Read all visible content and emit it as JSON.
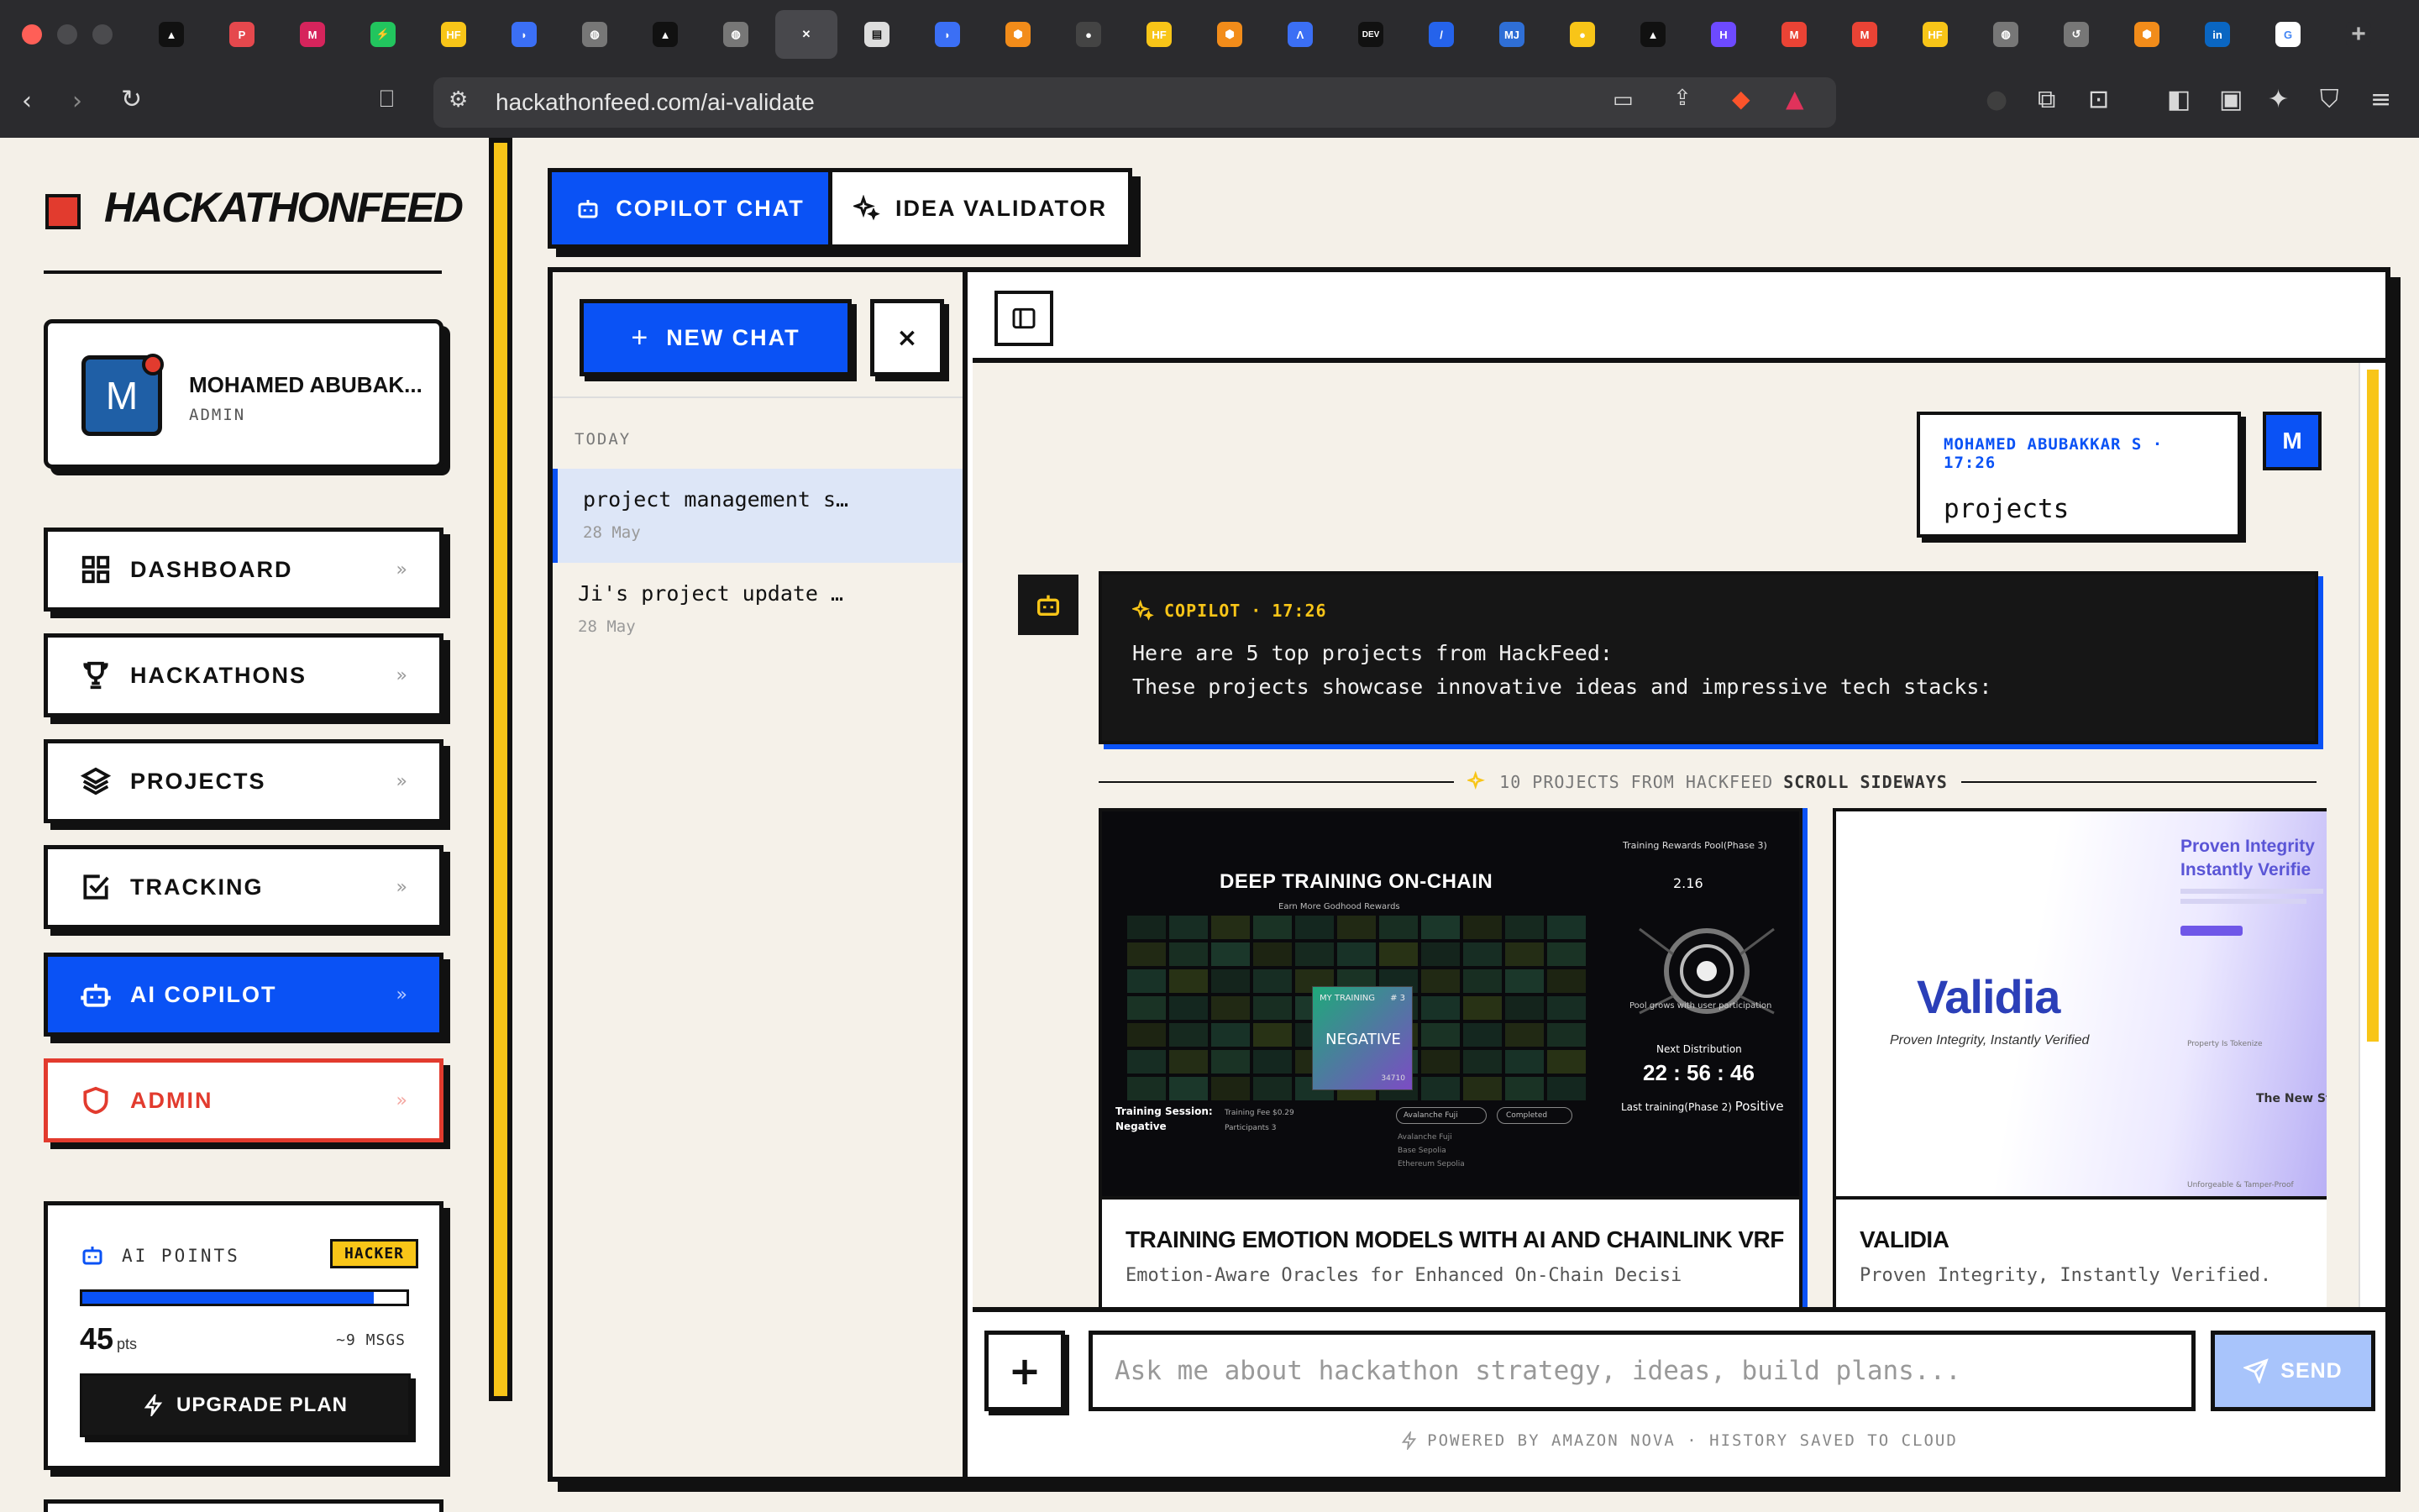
{
  "browser": {
    "url": "hackathonfeed.com/ai-validate",
    "tabs": [
      {
        "icon": "triangle-logo",
        "color": "#111111",
        "glyph": "▲"
      },
      {
        "icon": "producthunt-icon",
        "color": "#e5484d",
        "glyph": "P"
      },
      {
        "icon": "mail-icon",
        "color": "#d6245c",
        "glyph": "M"
      },
      {
        "icon": "bolt-icon",
        "color": "#22c55e",
        "glyph": "⚡"
      },
      {
        "icon": "hf-icon",
        "color": "#f8c518",
        "glyph": "HF"
      },
      {
        "icon": "blue-app-icon",
        "color": "#3b6ff5",
        "glyph": "◗"
      },
      {
        "icon": "globe-icon",
        "color": "#777777",
        "glyph": "◍"
      },
      {
        "icon": "triangle-logo",
        "color": "#111111",
        "glyph": "▲"
      },
      {
        "icon": "globe-icon",
        "color": "#777777",
        "glyph": "◍"
      },
      {
        "icon": "close-icon",
        "color": "#48484c",
        "glyph": "✕"
      },
      {
        "icon": "table-icon",
        "color": "#dddddd",
        "glyph": "▤"
      },
      {
        "icon": "blue-app-icon",
        "color": "#3b6ff5",
        "glyph": "◗"
      },
      {
        "icon": "cube-icon",
        "color": "#f28c1a",
        "glyph": "⬢"
      },
      {
        "icon": "github-icon",
        "color": "#444444",
        "glyph": "●"
      },
      {
        "icon": "hf-icon",
        "color": "#f8c518",
        "glyph": "HF"
      },
      {
        "icon": "cube-icon",
        "color": "#f28c1a",
        "glyph": "⬢"
      },
      {
        "icon": "a-logo-icon",
        "color": "#3b6ff5",
        "glyph": "Λ"
      },
      {
        "icon": "dev-icon",
        "color": "#111111",
        "glyph": "DEV"
      },
      {
        "icon": "slash-icon",
        "color": "#2563eb",
        "glyph": "/"
      },
      {
        "icon": "mj-icon",
        "color": "#2f6fd6",
        "glyph": "MJ"
      },
      {
        "icon": "bulb-icon",
        "color": "#f8c518",
        "glyph": "●"
      },
      {
        "icon": "triangle-logo",
        "color": "#111111",
        "glyph": "▲"
      },
      {
        "icon": "h-logo-icon",
        "color": "#6d4aff",
        "glyph": "H"
      },
      {
        "icon": "gmail-icon",
        "color": "#ea4335",
        "glyph": "M"
      },
      {
        "icon": "gmail-icon",
        "color": "#ea4335",
        "glyph": "M"
      },
      {
        "icon": "hf-icon",
        "color": "#f8c518",
        "glyph": "HF"
      },
      {
        "icon": "globe-icon",
        "color": "#777777",
        "glyph": "◍"
      },
      {
        "icon": "history-icon",
        "color": "#777777",
        "glyph": "↺"
      },
      {
        "icon": "cube-icon",
        "color": "#f28c1a",
        "glyph": "⬢"
      },
      {
        "icon": "linkedin-icon",
        "color": "#0a66c2",
        "glyph": "in"
      },
      {
        "icon": "google-icon",
        "color": "#ffffff",
        "glyph": "G"
      },
      {
        "icon": "new-tab-icon",
        "color": "#2b2b2e",
        "glyph": "+"
      }
    ]
  },
  "sidebar": {
    "logo": "HACKATHONFEED",
    "profile": {
      "initial": "M",
      "name": "MOHAMED ABUBAK...",
      "role": "ADMIN"
    },
    "nav": [
      {
        "label": "DASHBOARD",
        "icon": "grid-icon"
      },
      {
        "label": "HACKATHONS",
        "icon": "trophy-icon"
      },
      {
        "label": "PROJECTS",
        "icon": "layers-icon"
      },
      {
        "label": "TRACKING",
        "icon": "checkbox-icon"
      },
      {
        "label": "AI COPILOT",
        "icon": "robot-icon",
        "active": true
      },
      {
        "label": "ADMIN",
        "icon": "shield-icon",
        "danger": true
      }
    ],
    "nav_chevron": "»",
    "points": {
      "label": "AI POINTS",
      "badge": "HACKER",
      "value": "45",
      "unit": "pts",
      "messages": "~9 MSGS",
      "progress": 0.9,
      "upgrade_label": "UPGRADE PLAN"
    }
  },
  "mode_tabs": {
    "copilot": "COPILOT CHAT",
    "validator": "IDEA VALIDATOR"
  },
  "history": {
    "new_chat_label": "NEW CHAT",
    "close_glyph": "×",
    "section": "TODAY",
    "items": [
      {
        "title": "project management s…",
        "date": "28 May",
        "active": true
      },
      {
        "title": "Ji's project update …",
        "date": "28 May"
      }
    ]
  },
  "chat": {
    "user_message": {
      "author": "MOHAMED ABUBAKKAR S",
      "time": "17:26",
      "text": "projects",
      "avatar": "M"
    },
    "bot_message": {
      "author": "COPILOT",
      "time": "17:26",
      "lines": [
        "Here are 5 top projects from HackFeed:",
        "These projects showcase innovative ideas and impressive tech stacks:"
      ]
    },
    "projects_divider": {
      "label": "10 PROJECTS FROM HACKFEED",
      "hint": "SCROLL SIDEWAYS"
    },
    "projects": [
      {
        "title": "TRAINING EMOTION MODELS WITH AI AND CHAINLINK VRF",
        "tagline": "Emotion-Aware Oracles for Enhanced On-Chain Decisi",
        "preview": {
          "heading": "DEEP TRAINING ON-CHAIN",
          "sub": "Earn More Godhood Rewards",
          "pool_label": "Training Rewards Pool(Phase 3)",
          "pool_value": "2.16",
          "pool_note": "Pool grows with user participation",
          "next_label": "Next Distribution",
          "countdown": "22 : 56 : 46",
          "last_label": "Last training(Phase 2)",
          "last_value": "Positive",
          "card_label": "MY TRAINING",
          "card_num": "# 3",
          "card_value": "NEGATIVE",
          "card_small": "34710",
          "session_label": "Training Session:",
          "session_value": "Negative",
          "fee": "Training Fee $0.29",
          "participants": "Participants 3",
          "network": "Avalanche Fuji",
          "status": "Completed",
          "menu": [
            "Avalanche Fuji",
            "Base Sepolia",
            "Ethereum Sepolia"
          ]
        }
      },
      {
        "title": "VALIDIA",
        "tagline": "Proven Integrity, Instantly Verified.",
        "preview": {
          "logo": "Validia",
          "slogan": "Proven Integrity, Instantly Verified",
          "heading_1": "Proven Integrity",
          "heading_2": "Instantly Verifie",
          "side_text": "The New St",
          "side_small": "Property Is Tokenize",
          "side_small_2": "Unforgeable & Tamper-Proof"
        }
      }
    ]
  },
  "composer": {
    "placeholder": "Ask me about hackathon strategy, ideas, build plans...",
    "send_label": "SEND",
    "footer": "POWERED BY AMAZON NOVA · HISTORY SAVED TO CLOUD"
  }
}
